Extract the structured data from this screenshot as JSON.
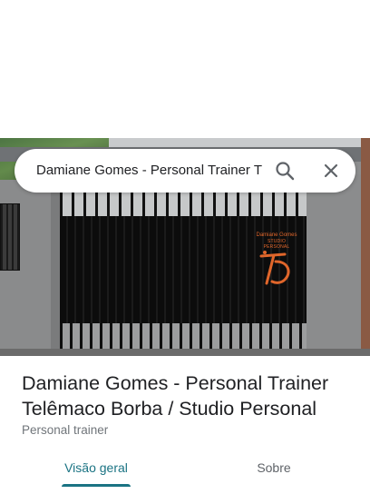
{
  "search": {
    "query": "Damiane Gomes - Personal Trainer T",
    "search_icon": "search-icon",
    "close_icon": "close-icon"
  },
  "photo": {
    "sign_line1": "Damiane Gomes",
    "sign_line2": "STUDIO PERSONAL"
  },
  "place": {
    "title_line1": "Damiane Gomes - Personal Trainer",
    "title_line2": "Telêmaco Borba / Studio Personal",
    "category": "Personal trainer"
  },
  "tabs": [
    {
      "label": "Visão geral",
      "selected": true
    },
    {
      "label": "Sobre",
      "selected": false
    }
  ],
  "colors": {
    "accent": "#1a7383",
    "title_text": "#202124",
    "secondary_text": "#70757a",
    "sign_orange": "#e0662b"
  }
}
